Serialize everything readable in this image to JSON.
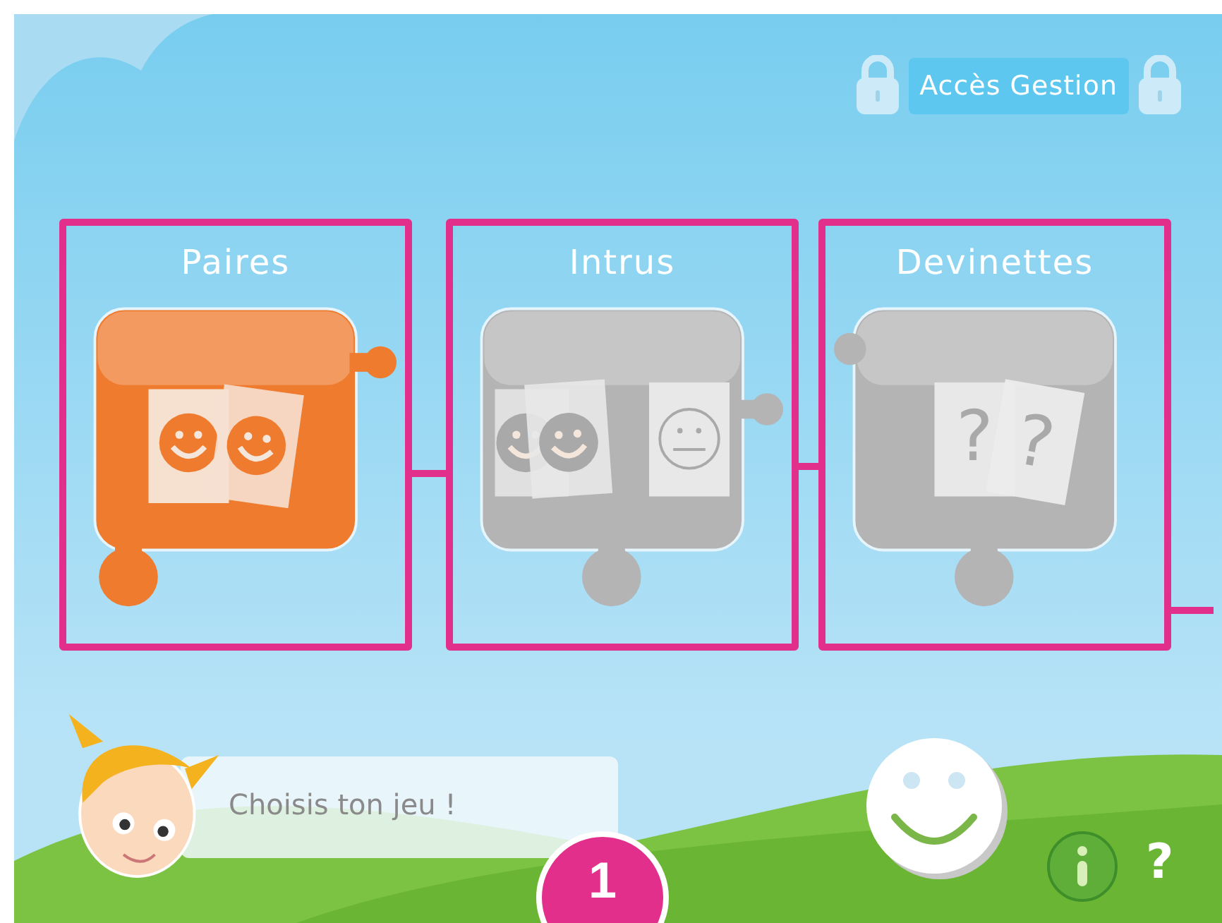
{
  "header": {
    "admin_button": "Accès Gestion"
  },
  "games": [
    {
      "title": "Paires",
      "kind": "pairs",
      "unlocked": true,
      "highlighted": true
    },
    {
      "title": "Intrus",
      "kind": "odd-one-out",
      "unlocked": false,
      "highlighted": true
    },
    {
      "title": "Devinettes",
      "kind": "riddles",
      "unlocked": false,
      "highlighted": true,
      "card_marks": [
        "?",
        "?"
      ]
    }
  ],
  "speech": {
    "text": "Choisis ton jeu !"
  },
  "footer": {
    "help_label": "?",
    "step_badge": "1"
  }
}
